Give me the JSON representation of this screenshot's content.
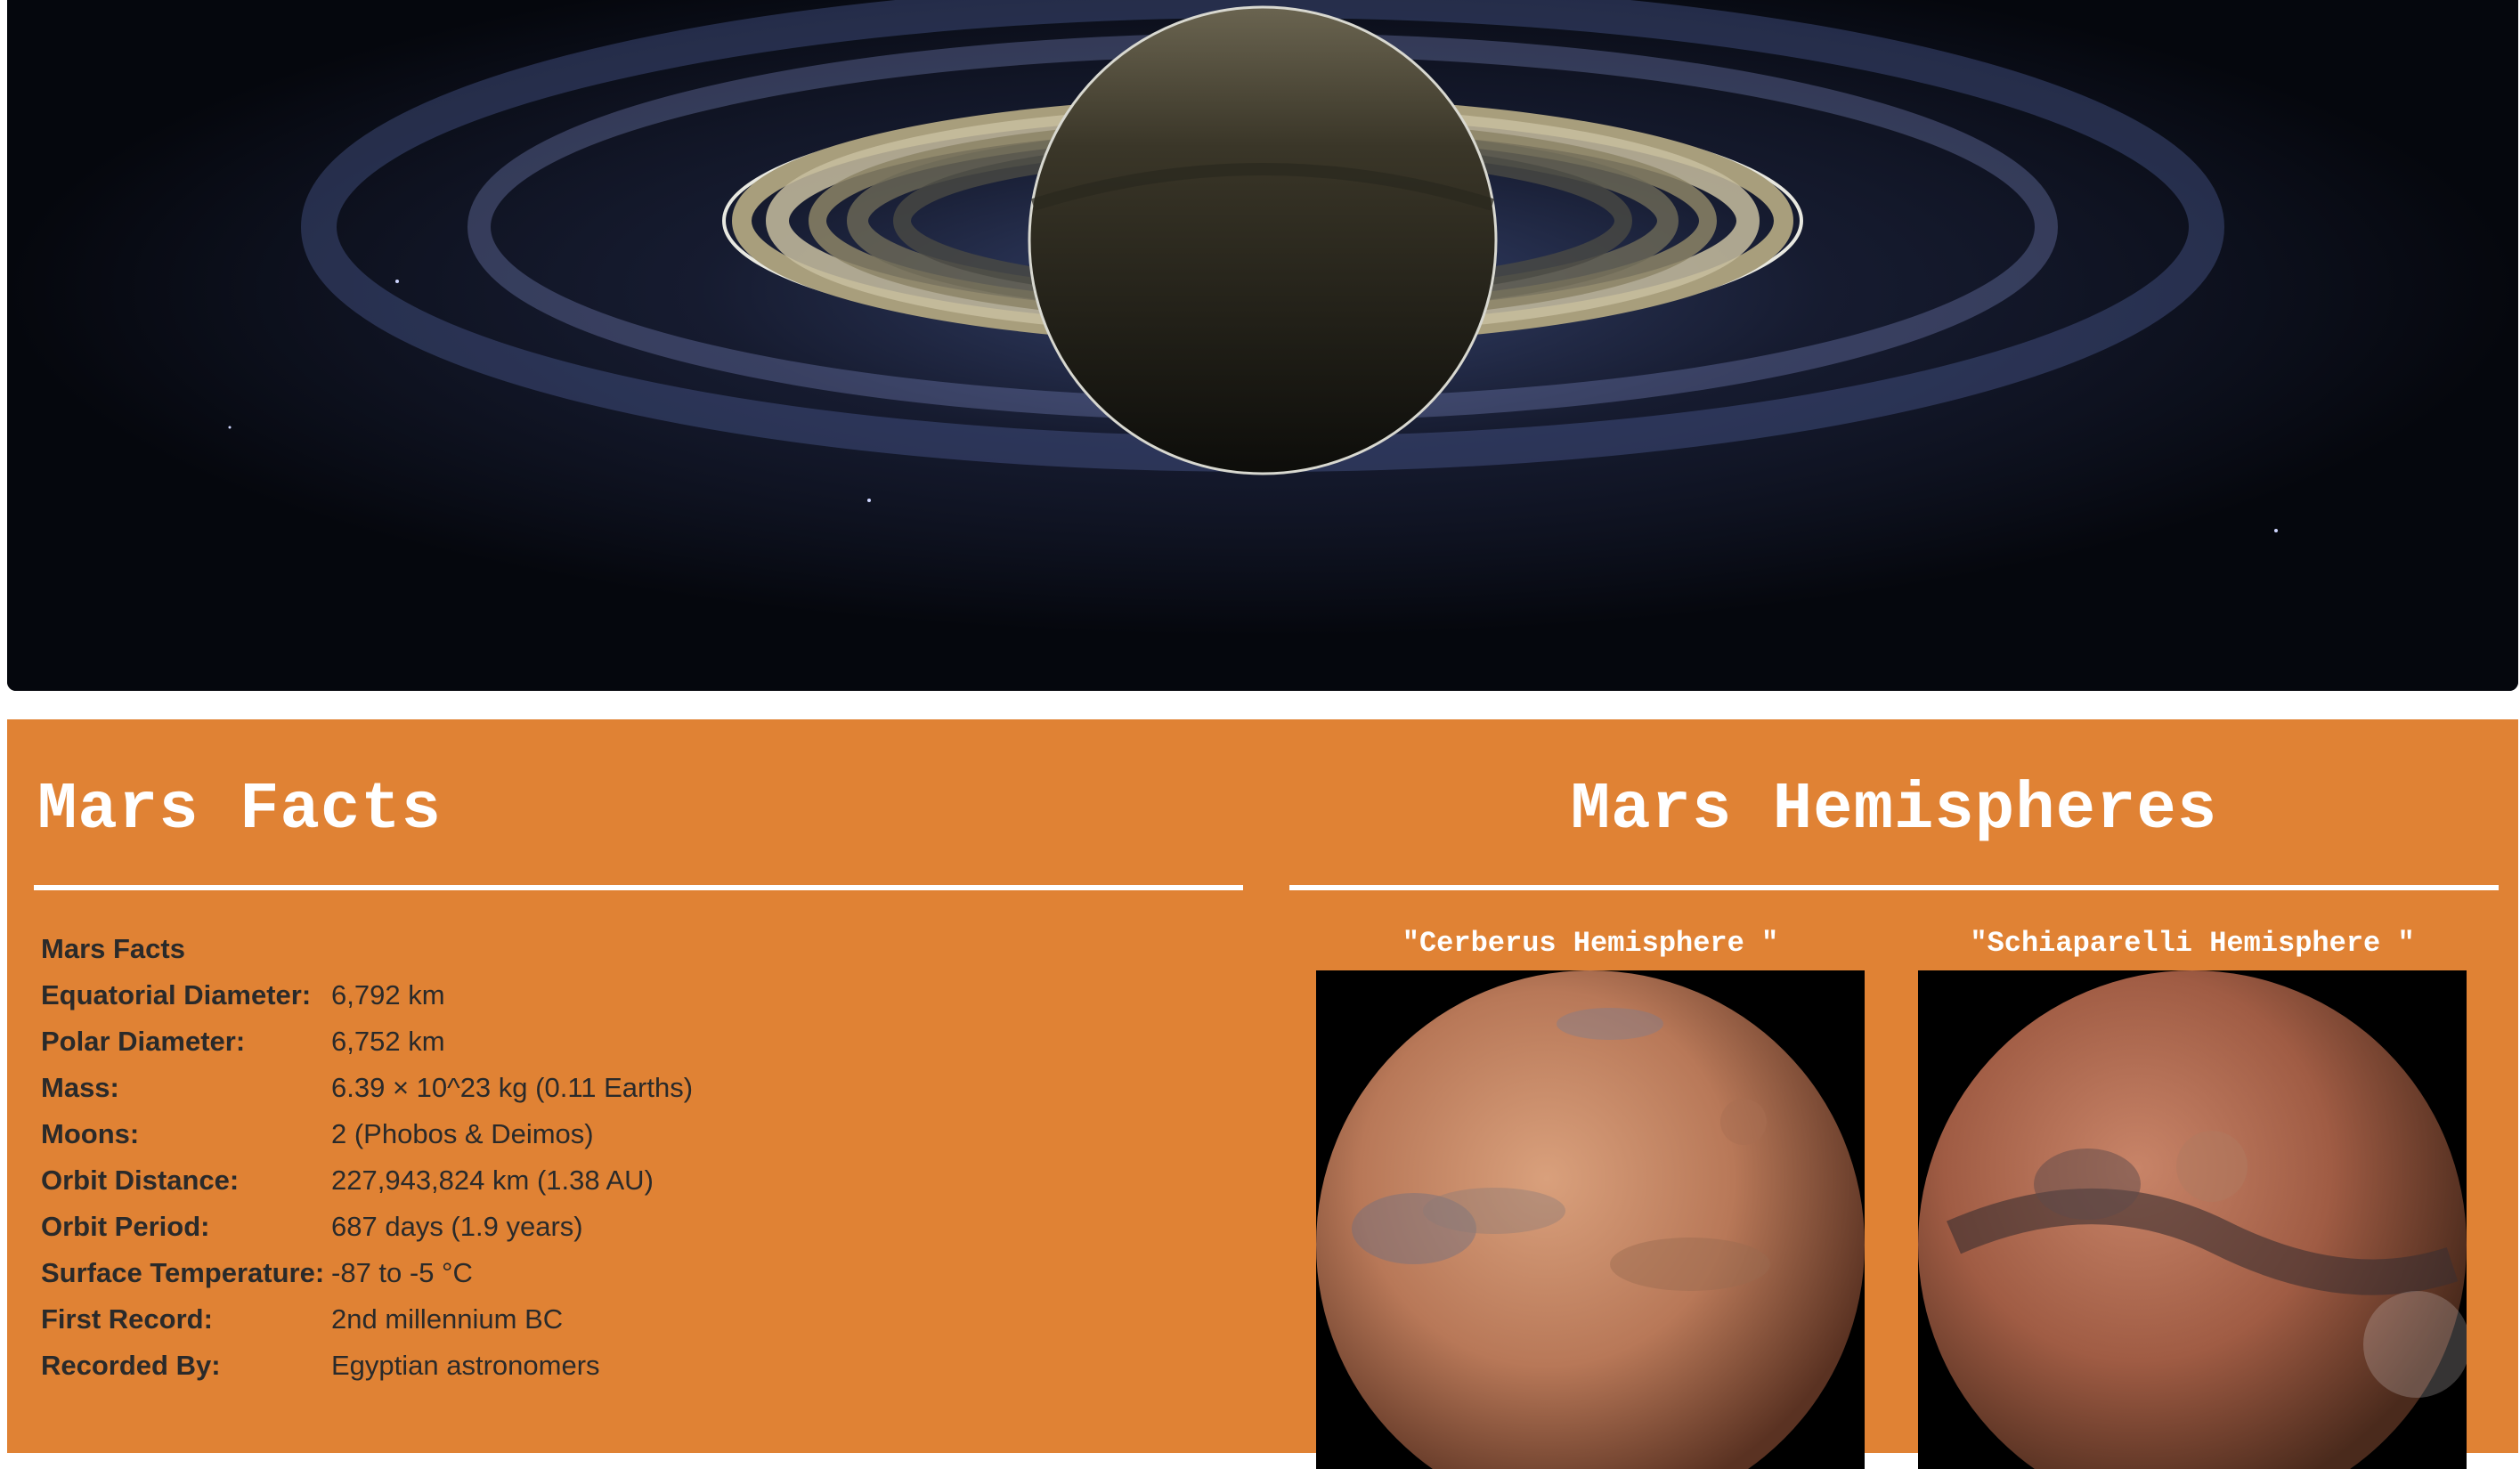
{
  "hero": {
    "image_subject": "saturn-backlit-rings"
  },
  "facts": {
    "heading": "Mars Facts",
    "table_caption": "Mars Facts",
    "rows": [
      {
        "label": "Equatorial Diameter:",
        "value": "6,792 km"
      },
      {
        "label": "Polar Diameter:",
        "value": "6,752 km"
      },
      {
        "label": "Mass:",
        "value": "6.39 × 10^23 kg (0.11 Earths)"
      },
      {
        "label": "Moons:",
        "value": "2 (Phobos & Deimos)"
      },
      {
        "label": "Orbit Distance:",
        "value": "227,943,824 km (1.38 AU)"
      },
      {
        "label": "Orbit Period:",
        "value": "687 days (1.9 years)"
      },
      {
        "label": "Surface Temperature:",
        "value": "-87 to -5 °C"
      },
      {
        "label": "First Record:",
        "value": "2nd millennium BC"
      },
      {
        "label": "Recorded By:",
        "value": "Egyptian astronomers"
      }
    ]
  },
  "hemispheres": {
    "heading": "Mars Hemispheres",
    "items": [
      {
        "title": "\"Cerberus Hemisphere \""
      },
      {
        "title": "\"Schiaparelli Hemisphere \""
      }
    ]
  },
  "colors": {
    "panel_background": "#e08234",
    "hero_background": "#05070d",
    "heading_text": "#ffffff",
    "body_text": "#2a2a2a"
  }
}
